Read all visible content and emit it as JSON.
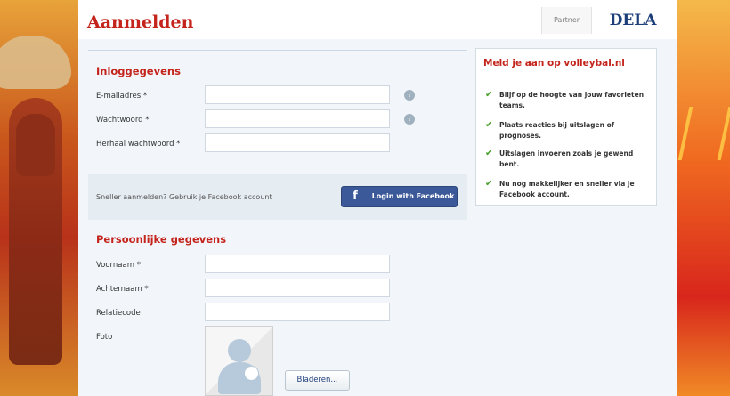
{
  "header": {
    "title": "Aanmelden",
    "partner_label": "Partner",
    "partner_logo": "DELA"
  },
  "login_section": {
    "title": "Inloggegevens",
    "fields": [
      {
        "label": "E-mailadres *",
        "value": "",
        "help": true
      },
      {
        "label": "Wachtwoord *",
        "value": "",
        "help": true
      },
      {
        "label": "Herhaal wachtwoord *",
        "value": "",
        "help": false
      }
    ],
    "help_icon_glyph": "?"
  },
  "facebook": {
    "prompt": "Sneller aanmelden? Gebruik je Facebook account",
    "icon_glyph": "f",
    "button_label": "Login with Facebook"
  },
  "personal_section": {
    "title": "Persoonlijke gegevens",
    "fields": [
      {
        "label": "Voornaam *",
        "value": ""
      },
      {
        "label": "Achternaam *",
        "value": ""
      },
      {
        "label": "Relatiecode",
        "value": ""
      }
    ],
    "photo_label": "Foto",
    "browse_label": "Bladeren..."
  },
  "sidebar": {
    "title": "Meld je aan op volleybal.nl",
    "check_glyph": "✔",
    "benefits": [
      "Blijf op de hoogte van jouw favorieten teams.",
      "Plaats reacties bij uitslagen of prognoses.",
      "Uitslagen invoeren zoals je gewend bent.",
      "Nu nog makkelijker en sneller via je Facebook account."
    ]
  },
  "colors": {
    "accent_red": "#c4241c",
    "facebook_blue": "#3b5998",
    "check_green": "#4aa02c"
  }
}
